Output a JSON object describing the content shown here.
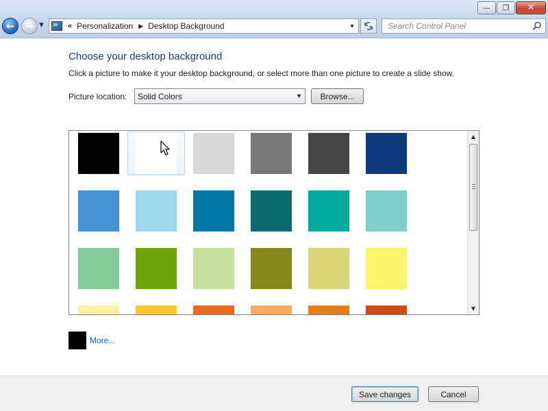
{
  "window": {
    "minimize_glyph": "—",
    "maximize_glyph": "❐",
    "close_glyph": "✕"
  },
  "nav": {
    "back_glyph": "←",
    "forward_glyph": "→"
  },
  "address": {
    "overflow": "«",
    "crumbs": [
      "Personalization",
      "Desktop Background"
    ]
  },
  "search": {
    "placeholder": "Search Control Panel"
  },
  "main": {
    "title": "Choose your desktop background",
    "description": "Click a picture to make it your desktop background, or select more than one picture to create a slide show.",
    "location_label": "Picture location:",
    "location_value": "Solid Colors",
    "browse_label": "Browse...",
    "more_label": "More...",
    "more_color": "#000000"
  },
  "swatches": [
    [
      "#000000",
      "#ffffff",
      "#d9d9d9",
      "#787878",
      "#464646",
      "#0e3b7e"
    ],
    [
      "#4592d4",
      "#9ed8ec",
      "#0077a7",
      "#0c6b6e",
      "#00aa9c",
      "#7ecec8"
    ],
    [
      "#84cb9a",
      "#6ea409",
      "#c6e09f",
      "#84891e",
      "#dad876",
      "#fef46a"
    ],
    [
      "#fef09e",
      "#fec627",
      "#ec6a1e",
      "#fcaa5e",
      "#ea7c14",
      "#cf4c10"
    ]
  ],
  "selected_swatch": {
    "row": 0,
    "col": 1
  },
  "footer": {
    "save_label": "Save changes",
    "cancel_label": "Cancel"
  }
}
